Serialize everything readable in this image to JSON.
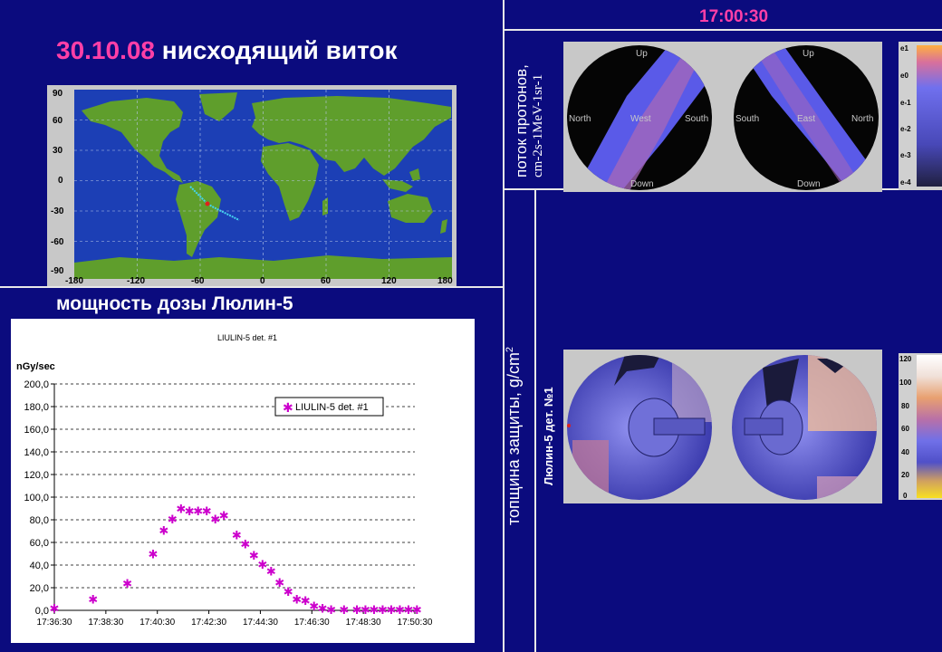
{
  "header": {
    "date": "30.10.08",
    "title_rest": "нисходящий виток",
    "time": "17:00:30"
  },
  "labels": {
    "proton_flux_line1": "поток протонов,",
    "proton_flux_line2": "cm-2s-1MeV-1sr-1",
    "shielding": "топщина защиты, g/cm",
    "shielding_sup": "2",
    "detector": "Люлин-5 дет. №1",
    "dose_rate_title": "мощность дозы Люлин-5"
  },
  "world_map": {
    "lat_ticks": [
      "90",
      "60",
      "30",
      "0",
      "-30",
      "-60",
      "-90"
    ],
    "lon_ticks": [
      "-180",
      "-120",
      "-60",
      "0",
      "60",
      "120",
      "180"
    ],
    "colors": {
      "ocean": "#1c3fb5",
      "land": "#5f9e2c",
      "track": "#45d5f0",
      "marker": "#e0201c"
    }
  },
  "proton_flux_spheres": {
    "left": {
      "up": "Up",
      "down": "Down",
      "left": "North",
      "center": "West",
      "right": "South"
    },
    "right": {
      "up": "Up",
      "down": "Down",
      "left": "South",
      "center": "East",
      "right": "North"
    },
    "scale": [
      "e1",
      "e0",
      "e-1",
      "e-2",
      "e-3",
      "e-4"
    ]
  },
  "shielding_spheres": {
    "scale": [
      "120",
      "100",
      "80",
      "60",
      "40",
      "20",
      "0"
    ]
  },
  "chart_data": {
    "type": "scatter",
    "title": "LIULIN-5 det. #1",
    "ylabel": "nGy/sec",
    "xlabel": "",
    "ylim": [
      0,
      200
    ],
    "yticks": [
      "200,0",
      "180,0",
      "160,0",
      "140,0",
      "120,0",
      "100,0",
      "80,0",
      "60,0",
      "40,0",
      "20,0",
      "0,0"
    ],
    "xticks": [
      "17:36:30",
      "17:38:30",
      "17:40:30",
      "17:42:30",
      "17:44:30",
      "17:46:30",
      "17:48:30",
      "17:50:30"
    ],
    "grid": true,
    "legend_position": "top-right",
    "marker_color": "#cc00cc",
    "series": [
      {
        "name": "LIULIN-5 det. #1",
        "points": [
          [
            "17:36:30",
            2
          ],
          [
            "17:38:00",
            10
          ],
          [
            "17:39:20",
            24
          ],
          [
            "17:40:20",
            50
          ],
          [
            "17:40:45",
            71
          ],
          [
            "17:41:05",
            81
          ],
          [
            "17:41:25",
            90
          ],
          [
            "17:41:45",
            88
          ],
          [
            "17:42:05",
            88
          ],
          [
            "17:42:25",
            88
          ],
          [
            "17:42:45",
            81
          ],
          [
            "17:43:05",
            84
          ],
          [
            "17:43:35",
            67
          ],
          [
            "17:43:55",
            59
          ],
          [
            "17:44:15",
            49
          ],
          [
            "17:44:35",
            41
          ],
          [
            "17:44:55",
            35
          ],
          [
            "17:45:15",
            25
          ],
          [
            "17:45:35",
            17
          ],
          [
            "17:45:55",
            10
          ],
          [
            "17:46:15",
            9
          ],
          [
            "17:46:35",
            4
          ],
          [
            "17:46:55",
            2
          ],
          [
            "17:47:15",
            1
          ],
          [
            "17:47:45",
            1
          ],
          [
            "17:48:15",
            1
          ],
          [
            "17:48:35",
            1
          ],
          [
            "17:48:55",
            1
          ],
          [
            "17:49:15",
            1
          ],
          [
            "17:49:35",
            1
          ],
          [
            "17:49:55",
            1
          ],
          [
            "17:50:15",
            1
          ],
          [
            "17:50:35",
            1
          ]
        ]
      }
    ]
  }
}
